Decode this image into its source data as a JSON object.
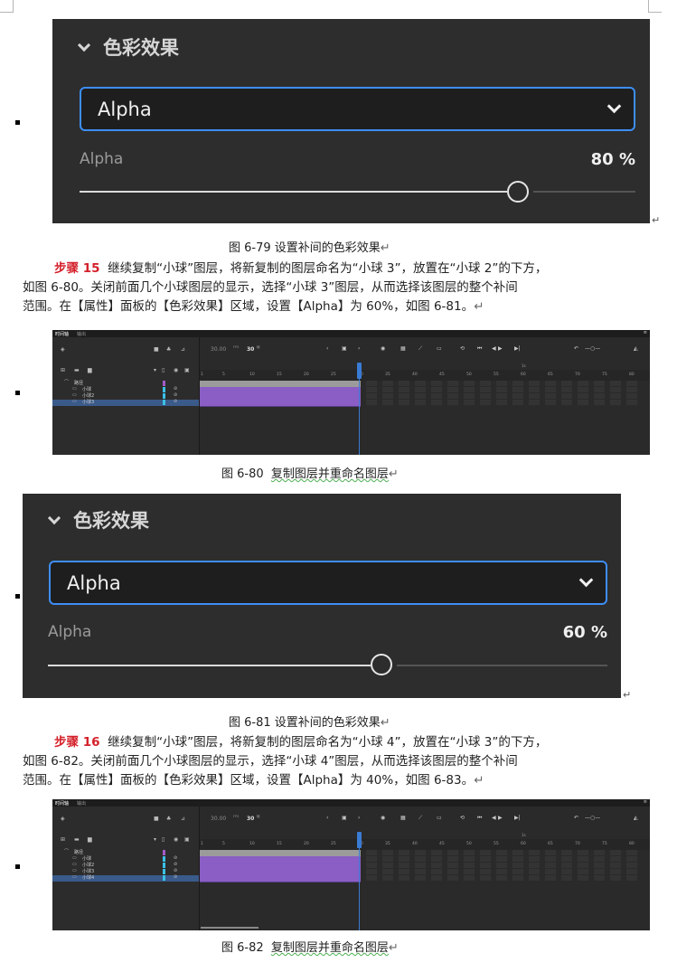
{
  "figures": {
    "fig79": {
      "panel_title": "色彩效果",
      "select_value": "Alpha",
      "prop_label": "Alpha",
      "prop_value": "80 %",
      "slider_fraction": 0.8,
      "caption": "图 6-79  设置补间的色彩效果"
    },
    "fig81": {
      "panel_title": "色彩效果",
      "select_value": "Alpha",
      "prop_label": "Alpha",
      "prop_value": "60 %",
      "slider_fraction": 0.6,
      "caption": "图 6-81  设置补间的色彩效果"
    },
    "fig80": {
      "caption_num": "图 6-80",
      "caption_text": "复制图层并重命名图层"
    },
    "fig82": {
      "caption_num": "图 6-82",
      "caption_text": "复制图层并重命名图层"
    }
  },
  "step15": {
    "label": "步骤 15",
    "line1": "继续复制“小球”图层，将新复制的图层命名为“小球 3”，放置在“小球 2”的下方，",
    "line2": "如图 6-80。关闭前面几个小球图层的显示，选择“小球 3”图层，从而选择该图层的整个补间",
    "line3": "范围。在【属性】面板的【色彩效果】区域，设置【Alpha】为 60%，如图 6-81。"
  },
  "step16": {
    "label": "步骤 16",
    "line1": "继续复制“小球”图层，将新复制的图层命名为“小球 4”，放置在“小球 3”的下方，",
    "line2": "如图 6-82。关闭前面几个小球图层的显示，选择“小球 4”图层，从而选择该图层的整个补间",
    "line3": "范围。在【属性】面板的【色彩效果】区域，设置【Alpha】为 40%，如图 6-83。"
  },
  "timeline": {
    "tabs": [
      "时间轴",
      "输出"
    ],
    "fps": "30.00",
    "fps_unit": "FPS",
    "frame": "30",
    "frame_unit": "帧",
    "ruler_marker": "1s",
    "ruler_ticks": [
      "1",
      "5",
      "10",
      "15",
      "20",
      "25",
      "30",
      "35",
      "40",
      "45",
      "50",
      "55",
      "60",
      "65",
      "70",
      "75",
      "80"
    ],
    "tl80_layers": [
      "路径",
      "小球",
      "小球2",
      "小球3"
    ],
    "tl82_layers": [
      "路径",
      "小球",
      "小球2",
      "小球3",
      "小球4"
    ]
  },
  "colors": {
    "panel_bg": "#2d2d2d",
    "select_border": "#3d8ef5",
    "step_red": "#d4202a",
    "tween_purple": "#8a5ec4",
    "playhead_blue": "#3a7bd5",
    "selected_row": "#3a5a8a"
  }
}
